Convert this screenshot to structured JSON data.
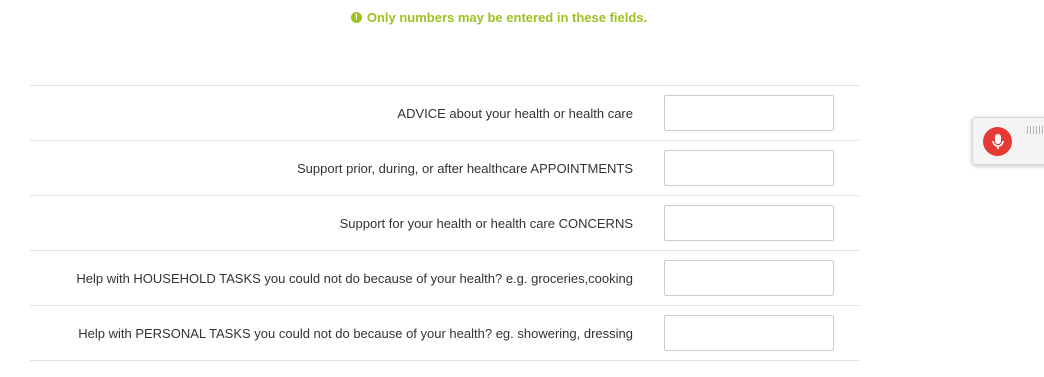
{
  "colors": {
    "notice": "#9cc21f",
    "mic_button": "#e53935"
  },
  "notice": {
    "icon": "exclamation-circle-icon",
    "text": "Only numbers may be entered in these fields."
  },
  "rows": [
    {
      "label": "ADVICE about your health or health care",
      "value": ""
    },
    {
      "label": "Support prior, during, or after healthcare APPOINTMENTS",
      "value": ""
    },
    {
      "label": "Support for your health or health care CONCERNS",
      "value": ""
    },
    {
      "label": "Help with HOUSEHOLD TASKS you could not do because of your health? e.g. groceries,cooking",
      "value": ""
    },
    {
      "label": "Help with PERSONAL TASKS you could not do because of your health? eg. showering, dressing",
      "value": ""
    }
  ],
  "mic_widget": {
    "icon": "microphone-icon",
    "grip_icon": "grip-icon"
  }
}
